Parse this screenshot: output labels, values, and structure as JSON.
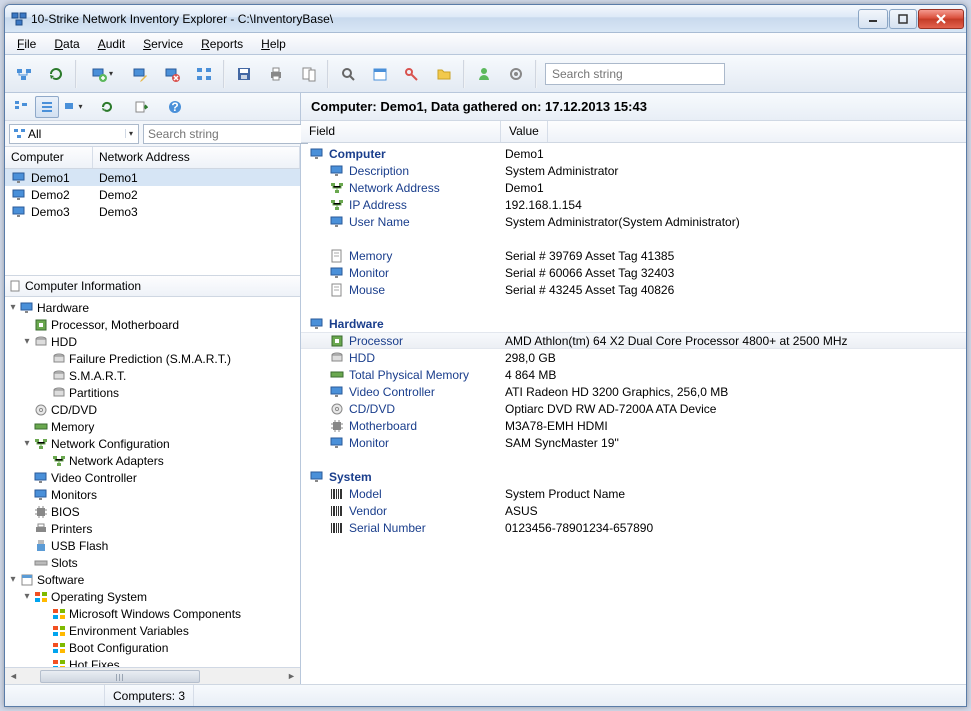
{
  "title": "10-Strike Network Inventory Explorer - C:\\InventoryBase\\",
  "menu": [
    "File",
    "Data",
    "Audit",
    "Service",
    "Reports",
    "Help"
  ],
  "toolbar_search_placeholder": "Search string",
  "filter_all": "All",
  "filter_search_placeholder": "Search string",
  "columns": {
    "computer": "Computer",
    "network": "Network Address"
  },
  "computers": [
    {
      "name": "Demo1",
      "addr": "Demo1",
      "selected": true
    },
    {
      "name": "Demo2",
      "addr": "Demo2",
      "selected": false
    },
    {
      "name": "Demo3",
      "addr": "Demo3",
      "selected": false
    }
  ],
  "section_title": "Computer Information",
  "tree": [
    {
      "t": "Hardware",
      "lvl": 0,
      "tw": "▾",
      "icon": "monitor"
    },
    {
      "t": "Processor, Motherboard",
      "lvl": 1,
      "tw": "",
      "icon": "cpu"
    },
    {
      "t": "HDD",
      "lvl": 1,
      "tw": "▾",
      "icon": "hdd"
    },
    {
      "t": "Failure Prediction (S.M.A.R.T.)",
      "lvl": 2,
      "tw": "",
      "icon": "hdd"
    },
    {
      "t": "S.M.A.R.T.",
      "lvl": 2,
      "tw": "",
      "icon": "hdd"
    },
    {
      "t": "Partitions",
      "lvl": 2,
      "tw": "",
      "icon": "hdd"
    },
    {
      "t": "CD/DVD",
      "lvl": 1,
      "tw": "",
      "icon": "cd"
    },
    {
      "t": "Memory",
      "lvl": 1,
      "tw": "",
      "icon": "mem"
    },
    {
      "t": "Network Configuration",
      "lvl": 1,
      "tw": "▾",
      "icon": "net"
    },
    {
      "t": "Network Adapters",
      "lvl": 2,
      "tw": "",
      "icon": "net"
    },
    {
      "t": "Video Controller",
      "lvl": 1,
      "tw": "",
      "icon": "monitor"
    },
    {
      "t": "Monitors",
      "lvl": 1,
      "tw": "",
      "icon": "monitor"
    },
    {
      "t": "BIOS",
      "lvl": 1,
      "tw": "",
      "icon": "chip"
    },
    {
      "t": "Printers",
      "lvl": 1,
      "tw": "",
      "icon": "printer"
    },
    {
      "t": "USB Flash",
      "lvl": 1,
      "tw": "",
      "icon": "usb"
    },
    {
      "t": "Slots",
      "lvl": 1,
      "tw": "",
      "icon": "slot"
    },
    {
      "t": "Software",
      "lvl": 0,
      "tw": "▾",
      "icon": "sw"
    },
    {
      "t": "Operating System",
      "lvl": 1,
      "tw": "▾",
      "icon": "os"
    },
    {
      "t": "Microsoft Windows Components",
      "lvl": 2,
      "tw": "",
      "icon": "os"
    },
    {
      "t": "Environment Variables",
      "lvl": 2,
      "tw": "",
      "icon": "os"
    },
    {
      "t": "Boot Configuration",
      "lvl": 2,
      "tw": "",
      "icon": "os"
    },
    {
      "t": "Hot Fixes",
      "lvl": 2,
      "tw": "",
      "icon": "os"
    }
  ],
  "right_title": "Computer: Demo1, Data gathered on: 17.12.2013 15:43",
  "detail_cols": {
    "field": "Field",
    "value": "Value"
  },
  "details": [
    {
      "type": "group",
      "field": "Computer",
      "value": "Demo1"
    },
    {
      "type": "sub",
      "field": "Description",
      "value": "System Administrator"
    },
    {
      "type": "sub",
      "field": "Network Address",
      "value": "Demo1"
    },
    {
      "type": "sub",
      "field": "IP Address",
      "value": "192.168.1.154"
    },
    {
      "type": "sub",
      "field": "User Name",
      "value": "System Administrator(System Administrator)"
    },
    {
      "type": "gap"
    },
    {
      "type": "sub",
      "field": "Memory",
      "value": "Serial # 39769 Asset Tag 41385"
    },
    {
      "type": "sub",
      "field": "Monitor",
      "value": "Serial # 60066 Asset Tag 32403"
    },
    {
      "type": "sub",
      "field": "Mouse",
      "value": "Serial # 43245 Asset Tag 40826"
    },
    {
      "type": "gap"
    },
    {
      "type": "group",
      "field": "Hardware",
      "value": ""
    },
    {
      "type": "sub",
      "field": "Processor",
      "value": "AMD Athlon(tm) 64 X2 Dual Core Processor 4800+ at 2500 MHz",
      "hover": true
    },
    {
      "type": "sub",
      "field": "HDD",
      "value": "298,0 GB"
    },
    {
      "type": "sub",
      "field": "Total Physical Memory",
      "value": "4 864 MB"
    },
    {
      "type": "sub",
      "field": "Video Controller",
      "value": "ATI Radeon HD 3200 Graphics, 256,0 MB"
    },
    {
      "type": "sub",
      "field": "CD/DVD",
      "value": "Optiarc DVD RW AD-7200A ATA Device"
    },
    {
      "type": "sub",
      "field": "Motherboard",
      "value": "M3A78-EMH HDMI"
    },
    {
      "type": "sub",
      "field": "Monitor",
      "value": "SAM SyncMaster 19''"
    },
    {
      "type": "gap"
    },
    {
      "type": "group",
      "field": "System",
      "value": ""
    },
    {
      "type": "sub",
      "field": "Model",
      "value": "System Product Name"
    },
    {
      "type": "sub",
      "field": "Vendor",
      "value": "ASUS"
    },
    {
      "type": "sub",
      "field": "Serial Number",
      "value": "0123456-78901234-657890"
    }
  ],
  "status": "Computers: 3"
}
